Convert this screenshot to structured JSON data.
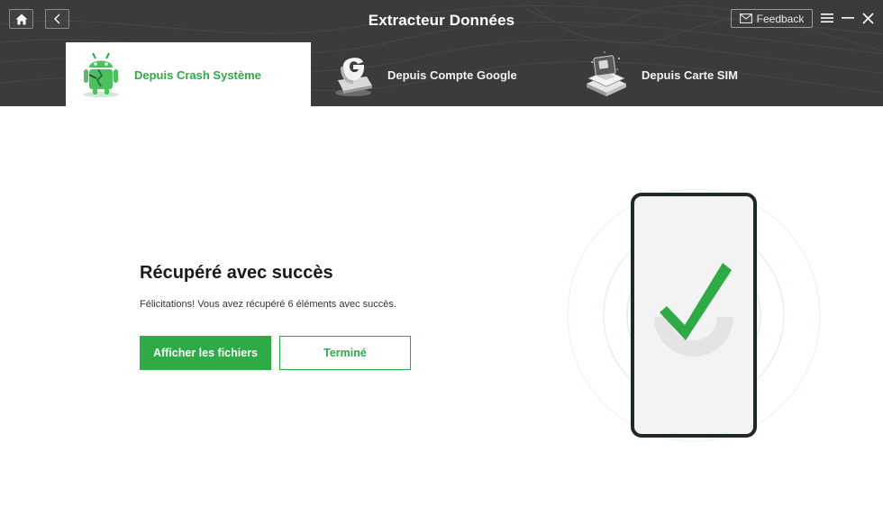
{
  "window": {
    "title": "Extracteur Données",
    "feedback_label": "Feedback",
    "icons": [
      "home-icon",
      "back-arrow-icon",
      "mail-icon",
      "menu-icon",
      "minimize-icon",
      "close-icon"
    ]
  },
  "tabs": [
    {
      "label": "Depuis Crash Système",
      "icon": "android-crash-icon",
      "active": true
    },
    {
      "label": "Depuis Compte Google",
      "icon": "google-account-icon",
      "active": false
    },
    {
      "label": "Depuis Carte SIM",
      "icon": "sim-card-icon",
      "active": false
    }
  ],
  "result": {
    "title": "Récupéré avec succès",
    "message": "Félicitations! Vous avez récupéré 6 éléments avec succès.",
    "primary_button": "Afficher les fichiers",
    "secondary_button": "Terminé",
    "illustration_icon": "phone-checkmark-icon"
  },
  "colors": {
    "accent": "#2eaa47",
    "header_bg": "#3b3b3b",
    "phone_border": "#1f2a24"
  }
}
